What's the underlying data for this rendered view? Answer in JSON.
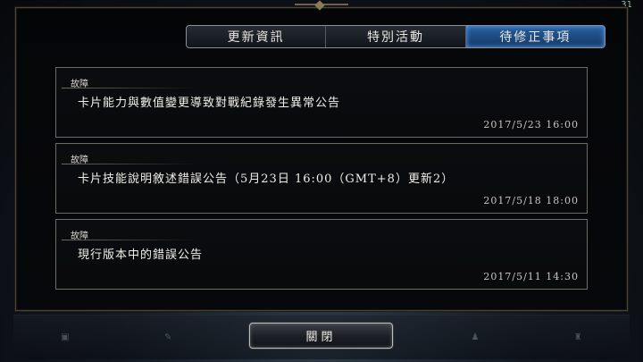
{
  "status": {
    "battery": "31"
  },
  "tabs": [
    {
      "label": "更新資訊",
      "active": false
    },
    {
      "label": "特別活動",
      "active": false
    },
    {
      "label": "待修正事項",
      "active": true
    }
  ],
  "notices": [
    {
      "tag": "故障",
      "title": "卡片能力與數值變更導致對戰紀錄發生異常公告",
      "date": "2017/5/23 16:00"
    },
    {
      "tag": "故障",
      "title": "卡片技能說明敘述錯誤公告（5月23日 16:00（GMT+8）更新2）",
      "date": "2017/5/18 18:00"
    },
    {
      "tag": "故障",
      "title": "現行版本中的錯誤公告",
      "date": "2017/5/11 14:30"
    }
  ],
  "footer": {
    "close_label": "關閉"
  },
  "colors": {
    "active_tab": "#1f4f8a",
    "panel_border": "#4a453a",
    "background": "#06080b"
  }
}
